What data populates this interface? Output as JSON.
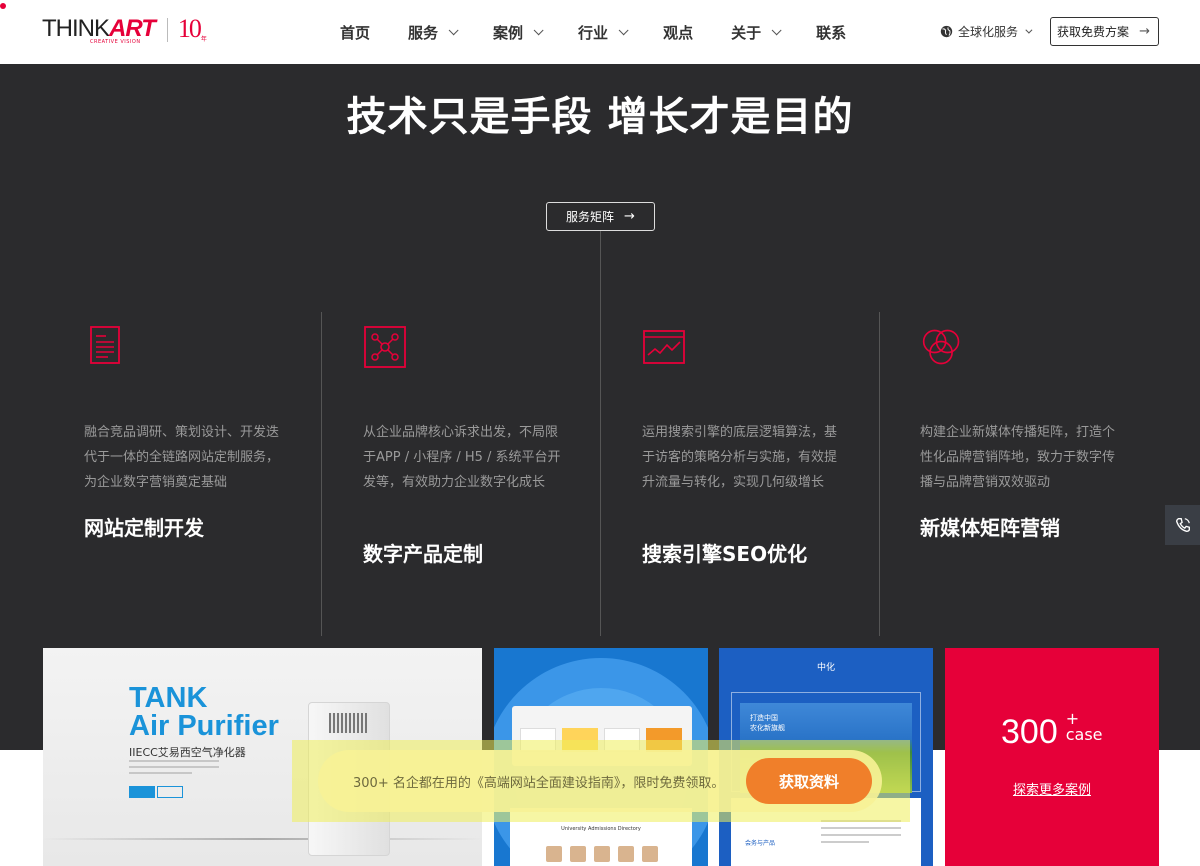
{
  "brand": {
    "logo_word_think": "THINK",
    "logo_word_art": "ART",
    "logo_tagline": "CREATIVE VISION",
    "anniversary": "10",
    "anniversary_unit": "年"
  },
  "nav": {
    "items": [
      {
        "label": "首页",
        "has_dropdown": false
      },
      {
        "label": "服务",
        "has_dropdown": true
      },
      {
        "label": "案例",
        "has_dropdown": true
      },
      {
        "label": "行业",
        "has_dropdown": true
      },
      {
        "label": "观点",
        "has_dropdown": false
      },
      {
        "label": "关于",
        "has_dropdown": true
      },
      {
        "label": "联系",
        "has_dropdown": false
      }
    ],
    "global_label": "全球化服务",
    "cta_label": "获取免费方案"
  },
  "hero": {
    "title": "技术只是手段 增长才是目的",
    "matrix_button": "服务矩阵"
  },
  "services": [
    {
      "icon": "document-list-icon",
      "desc": "融合竞品调研、策划设计、开发迭代于一体的全链路网站定制服务，为企业数字营销奠定基础",
      "title": "网站定制开发"
    },
    {
      "icon": "network-nodes-icon",
      "desc": "从企业品牌核心诉求出发，不局限于APP / 小程序 / H5 / 系统平台开发等，有效助力企业数字化成长",
      "title": "数字产品定制"
    },
    {
      "icon": "analytics-chart-icon",
      "desc": "运用搜索引擎的底层逻辑算法，基于访客的策略分析与实施，有效提升流量与转化，实现几何级增长",
      "title": "搜索引擎SEO优化"
    },
    {
      "icon": "overlapping-circles-icon",
      "desc": "构建企业新媒体传播矩阵，打造个性化品牌营销阵地，致力于数字传播与品牌营销双效驱动",
      "title": "新媒体矩阵营销"
    }
  ],
  "cases": {
    "tank": {
      "title_line1": "TANK",
      "title_line2": "Air Purifier",
      "subtitle": "IIECC艾易西空气净化器"
    },
    "university": {
      "page_title": "University Admissions Directory"
    },
    "zhonghua": {
      "logo": "中化",
      "headline_1": "打造中国",
      "headline_2": "农化新旗舰",
      "tag": "会务与产品"
    },
    "summary": {
      "count": "300",
      "plus": "+",
      "unit": "case",
      "link": "探索更多案例"
    }
  },
  "promo": {
    "text": "300+ 名企都在用的《高端网站全面建设指南》，限时免费领取。",
    "button": "获取资料"
  },
  "colors": {
    "brand_red": "#e60039",
    "dark_bg": "#2b2b2d",
    "promo_orange": "#f07f2a"
  }
}
